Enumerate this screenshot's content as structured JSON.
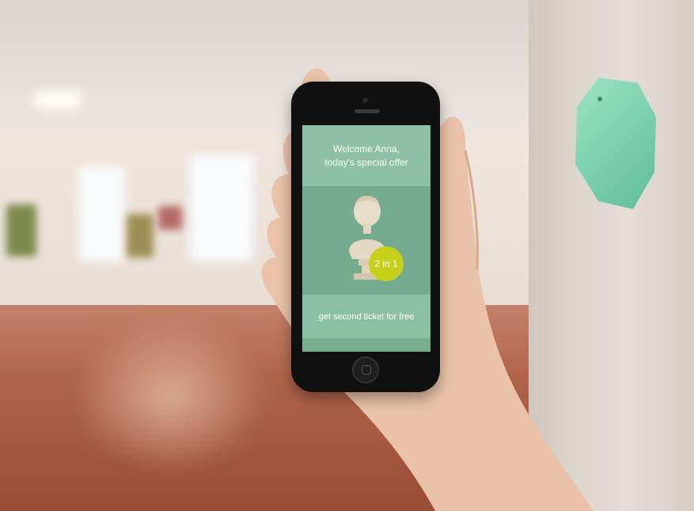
{
  "phone_screen": {
    "header_line1": "Welcome Anna,",
    "header_line2": "today's special offer",
    "badge_text": "2 in 1",
    "footer_text": "get second ticket for free"
  },
  "colors": {
    "beacon": "#7fd3b2",
    "screen_bg": "#77ae91",
    "badge": "#c7d11c",
    "floor": "#b0654a"
  },
  "icons": [
    "bust-statue-illustration",
    "proximity-beacon"
  ]
}
